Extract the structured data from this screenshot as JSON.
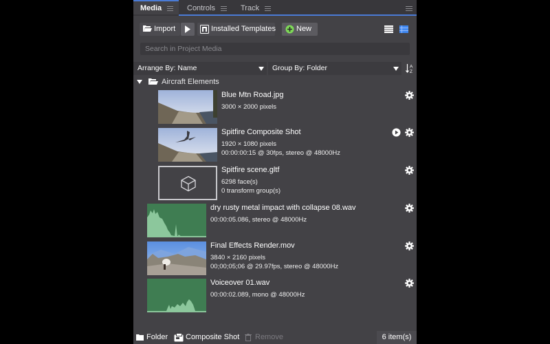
{
  "tabs": [
    {
      "label": "Media",
      "active": true
    },
    {
      "label": "Controls",
      "active": false
    },
    {
      "label": "Track",
      "active": false
    }
  ],
  "toolbar": {
    "import_label": "Import",
    "templates_label": "Installed Templates",
    "new_label": "New",
    "view_modes": [
      "list-view-icon",
      "detail-view-icon"
    ],
    "active_view": "detail-view-icon"
  },
  "search": {
    "placeholder": "Search in Project Media",
    "value": ""
  },
  "arrange": {
    "arrange_by": "Arrange By: Name",
    "group_by": "Group By: Folder"
  },
  "folder": {
    "name": "Aircraft Elements",
    "expanded": true
  },
  "items": [
    {
      "name": "Blue Mtn Road.jpg",
      "meta": [
        "3000 × 2000 pixels"
      ],
      "type": "image",
      "play": false
    },
    {
      "name": "Spitfire Composite Shot",
      "meta": [
        "1920 × 1080 pixels",
        "00:00:00:15 @ 30fps, stereo @ 48000Hz"
      ],
      "type": "composite",
      "play": true
    },
    {
      "name": "Spitfire scene.gltf",
      "meta": [
        "6298 face(s)",
        "0 transform group(s)"
      ],
      "type": "3d",
      "play": false
    },
    {
      "name": "dry rusty metal impact with collapse 08.wav",
      "meta": [
        "00:00:05.086, stereo @ 48000Hz"
      ],
      "type": "audio",
      "play": false
    },
    {
      "name": "Final Effects Render.mov",
      "meta": [
        "3840 × 2160 pixels",
        "00;00;05;06 @ 29.97fps, stereo @ 48000Hz"
      ],
      "type": "video",
      "play": false
    },
    {
      "name": "Voiceover 01.wav",
      "meta": [
        "00:00:02.089, mono @ 48000Hz"
      ],
      "type": "audio",
      "play": false
    }
  ],
  "footer": {
    "folder_label": "Folder",
    "composite_label": "Composite Shot",
    "remove_label": "Remove",
    "count": "6 item(s)"
  },
  "colors": {
    "accent": "#4a7bd6",
    "panel_bg": "#434246",
    "audio_bg": "#3f7d52",
    "audio_wave": "#8cc79c",
    "new_icon": "#7ed957"
  }
}
